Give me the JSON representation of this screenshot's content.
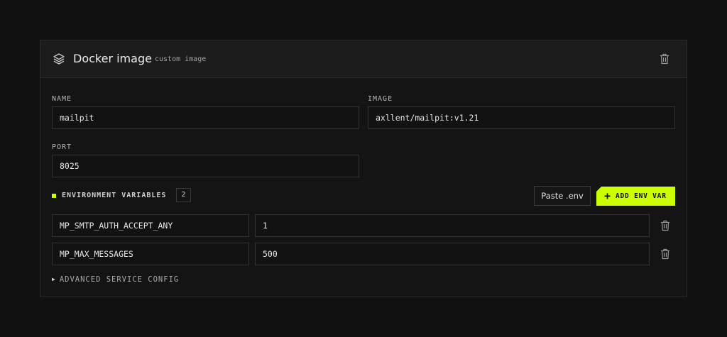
{
  "header": {
    "title": "Docker image",
    "subtitle": "custom image",
    "icon": "layers-icon"
  },
  "fields": {
    "name": {
      "label": "NAME",
      "value": "mailpit"
    },
    "image": {
      "label": "IMAGE",
      "value": "axllent/mailpit:v1.21"
    },
    "port": {
      "label": "PORT",
      "value": "8025"
    }
  },
  "env": {
    "label": "ENVIRONMENT VARIABLES",
    "count": "2",
    "paste_label": "Paste .env",
    "add_label": "ADD ENV VAR",
    "accent_color": "#ccff00",
    "vars": [
      {
        "key": "MP_SMTP_AUTH_ACCEPT_ANY",
        "value": "1"
      },
      {
        "key": "MP_MAX_MESSAGES",
        "value": "500"
      }
    ]
  },
  "advanced": {
    "label": "ADVANCED SERVICE CONFIG"
  }
}
